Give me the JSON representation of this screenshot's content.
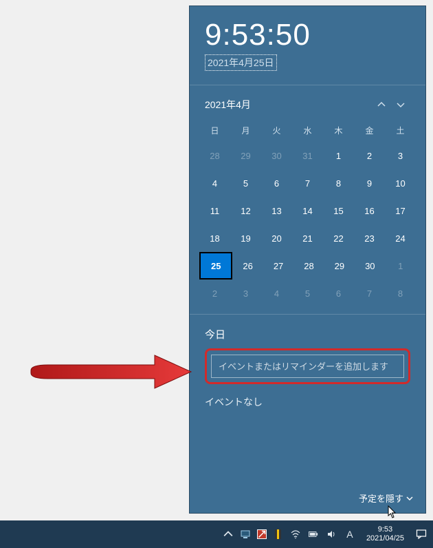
{
  "clock": {
    "time": "9:53:50",
    "date": "2021年4月25日"
  },
  "calendar": {
    "month_label": "2021年4月",
    "dow": [
      "日",
      "月",
      "火",
      "水",
      "木",
      "金",
      "土"
    ],
    "weeks": [
      [
        {
          "d": "28",
          "o": true
        },
        {
          "d": "29",
          "o": true
        },
        {
          "d": "30",
          "o": true
        },
        {
          "d": "31",
          "o": true
        },
        {
          "d": "1"
        },
        {
          "d": "2"
        },
        {
          "d": "3"
        }
      ],
      [
        {
          "d": "4"
        },
        {
          "d": "5"
        },
        {
          "d": "6"
        },
        {
          "d": "7"
        },
        {
          "d": "8"
        },
        {
          "d": "9"
        },
        {
          "d": "10"
        }
      ],
      [
        {
          "d": "11"
        },
        {
          "d": "12"
        },
        {
          "d": "13"
        },
        {
          "d": "14"
        },
        {
          "d": "15"
        },
        {
          "d": "16"
        },
        {
          "d": "17"
        }
      ],
      [
        {
          "d": "18"
        },
        {
          "d": "19"
        },
        {
          "d": "20"
        },
        {
          "d": "21"
        },
        {
          "d": "22"
        },
        {
          "d": "23"
        },
        {
          "d": "24"
        }
      ],
      [
        {
          "d": "25",
          "t": true
        },
        {
          "d": "26"
        },
        {
          "d": "27"
        },
        {
          "d": "28"
        },
        {
          "d": "29"
        },
        {
          "d": "30"
        },
        {
          "d": "1",
          "o": true
        }
      ],
      [
        {
          "d": "2",
          "o": true
        },
        {
          "d": "3",
          "o": true
        },
        {
          "d": "4",
          "o": true
        },
        {
          "d": "5",
          "o": true
        },
        {
          "d": "6",
          "o": true
        },
        {
          "d": "7",
          "o": true
        },
        {
          "d": "8",
          "o": true
        }
      ]
    ]
  },
  "agenda": {
    "title": "今日",
    "placeholder": "イベントまたはリマインダーを追加します",
    "no_events": "イベントなし",
    "hide_label": "予定を隠す"
  },
  "taskbar": {
    "ime": "A",
    "clock_time": "9:53",
    "clock_date": "2021/04/25"
  }
}
